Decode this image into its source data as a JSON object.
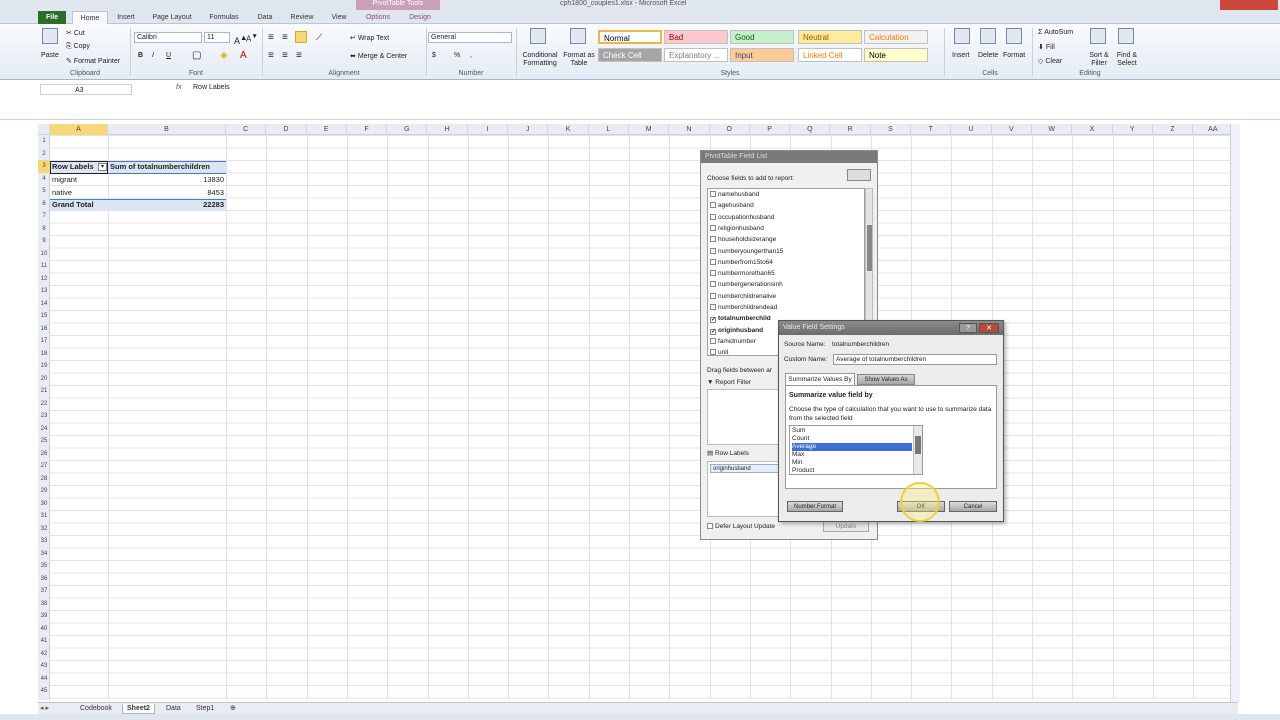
{
  "window": {
    "title": "cph1800_couples1.xlsx - Microsoft Excel",
    "context_tab_group": "PivotTable Tools"
  },
  "tabs": [
    "File",
    "Home",
    "Insert",
    "Page Layout",
    "Formulas",
    "Data",
    "Review",
    "View",
    "Options",
    "Design"
  ],
  "ribbon": {
    "clipboard": {
      "paste": "Paste",
      "cut": "Cut",
      "copy": "Copy",
      "format_painter": "Format Painter",
      "label": "Clipboard"
    },
    "font": {
      "name": "Calibri",
      "size": "11",
      "bold": "B",
      "italic": "I",
      "underline": "U",
      "label": "Font"
    },
    "alignment": {
      "wrap": "Wrap Text",
      "merge": "Merge & Center",
      "label": "Alignment"
    },
    "number": {
      "format": "General",
      "currency": "$",
      "percent": "%",
      "comma": ",",
      "label": "Number"
    },
    "styles": {
      "conditional": "Conditional Formatting",
      "format_table": "Format as Table",
      "cells": [
        {
          "name": "Normal",
          "bg": "#ffffff",
          "fg": "#000000"
        },
        {
          "name": "Bad",
          "bg": "#ffc7ce",
          "fg": "#9c0006"
        },
        {
          "name": "Good",
          "bg": "#c6efce",
          "fg": "#006100"
        },
        {
          "name": "Neutral",
          "bg": "#ffeb9c",
          "fg": "#9c5700"
        },
        {
          "name": "Calculation",
          "bg": "#f2f2f2",
          "fg": "#fa7d00"
        },
        {
          "name": "Check Cell",
          "bg": "#a5a5a5",
          "fg": "#ffffff"
        },
        {
          "name": "Explanatory ...",
          "bg": "#ffffff",
          "fg": "#7f7f7f"
        },
        {
          "name": "Input",
          "bg": "#ffcc99",
          "fg": "#3f3f76"
        },
        {
          "name": "Linked Cell",
          "bg": "#ffffff",
          "fg": "#fa7d00"
        },
        {
          "name": "Note",
          "bg": "#ffffcc",
          "fg": "#000000"
        }
      ],
      "label": "Styles"
    },
    "cells": {
      "insert": "Insert",
      "delete": "Delete",
      "format": "Format",
      "label": "Cells"
    },
    "editing": {
      "autosum": "AutoSum",
      "fill": "Fill",
      "clear": "Clear",
      "sort": "Sort & Filter",
      "find": "Find & Select",
      "label": "Editing"
    }
  },
  "formula_bar": {
    "name_box": "A3",
    "fx": "fx",
    "content": "Row Labels"
  },
  "columns": [
    "A",
    "B",
    "C",
    "D",
    "E",
    "F",
    "G",
    "H",
    "I",
    "J",
    "K",
    "L",
    "M",
    "N",
    "O",
    "P",
    "Q",
    "R",
    "S",
    "T",
    "U",
    "V",
    "W",
    "X",
    "Y",
    "Z",
    "AA"
  ],
  "pivot": {
    "header_row_labels": "Row Labels",
    "header_sum": "Sum of totalnumberchildren",
    "rows": [
      {
        "label": "migrant",
        "value": "13830"
      },
      {
        "label": "native",
        "value": "8453"
      }
    ],
    "grand_total_label": "Grand Total",
    "grand_total_value": "22283"
  },
  "field_list": {
    "title": "PivotTable Field List",
    "choose_label": "Choose fields to add to report:",
    "fields": [
      {
        "name": "namehusband",
        "checked": false
      },
      {
        "name": "agehusband",
        "checked": false
      },
      {
        "name": "occupationhusband",
        "checked": false
      },
      {
        "name": "religionhusband",
        "checked": false
      },
      {
        "name": "householdsizerange",
        "checked": false
      },
      {
        "name": "numberyoungerthan15",
        "checked": false
      },
      {
        "name": "numberfrom15to64",
        "checked": false
      },
      {
        "name": "numbermorethan65",
        "checked": false
      },
      {
        "name": "numbergenerationsinh",
        "checked": false
      },
      {
        "name": "numberchildrenalive",
        "checked": false
      },
      {
        "name": "numberchildrendead",
        "checked": false
      },
      {
        "name": "totalnumberchild",
        "checked": true
      },
      {
        "name": "originhusband",
        "checked": true
      },
      {
        "name": "famidnumber",
        "checked": false
      },
      {
        "name": "unit",
        "checked": false
      }
    ],
    "drag_label": "Drag fields between ar",
    "report_filter": "Report Filter",
    "row_labels": "Row Labels",
    "row_field": "originhusband",
    "defer_label": "Defer Layout Update",
    "update_button": "Update"
  },
  "dialog": {
    "title": "Value Field Settings",
    "source_label": "Source Name:",
    "source_value": "totalnumberchildren",
    "custom_label": "Custom Name:",
    "custom_value": "Average of totalnumberchildren",
    "tab_summarize": "Summarize Values By",
    "tab_show": "Show Values As",
    "heading": "Summarize value field by",
    "description": "Choose the type of calculation that you want to use to summarize data from the selected field",
    "options": [
      "Sum",
      "Count",
      "Average",
      "Max",
      "Min",
      "Product"
    ],
    "selected": "Average",
    "number_format": "Number Format",
    "ok": "OK",
    "cancel": "Cancel"
  },
  "sheets": [
    "Codebook",
    "Sheet2",
    "Data",
    "Step1"
  ],
  "active_sheet": "Sheet2"
}
